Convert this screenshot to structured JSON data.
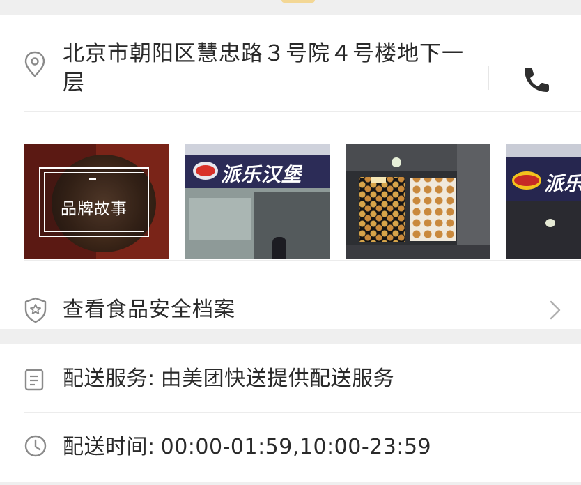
{
  "address": {
    "text": "北京市朝阳区慧忠路３号院４号楼地下一层"
  },
  "photos": {
    "brand_story_label": "品牌故事",
    "sign_text_1": "派乐汉堡",
    "sign_text_4": "派乐"
  },
  "safety": {
    "label": "查看食品安全档案"
  },
  "delivery": {
    "label": "配送服务:",
    "value": "由美团快送提供配送服务"
  },
  "hours": {
    "label": "配送时间:",
    "value": "00:00-01:59,10:00-23:59"
  },
  "icons": {
    "address": "location-pin-icon",
    "phone": "phone-icon",
    "safety": "shield-star-icon",
    "chevron": "chevron-right-icon",
    "delivery": "document-icon",
    "hours": "clock-icon"
  },
  "colors": {
    "accent": "#f5c24b",
    "icon_gray": "#8a8a8a",
    "text": "#2a2a2a",
    "background": "#efefef"
  }
}
